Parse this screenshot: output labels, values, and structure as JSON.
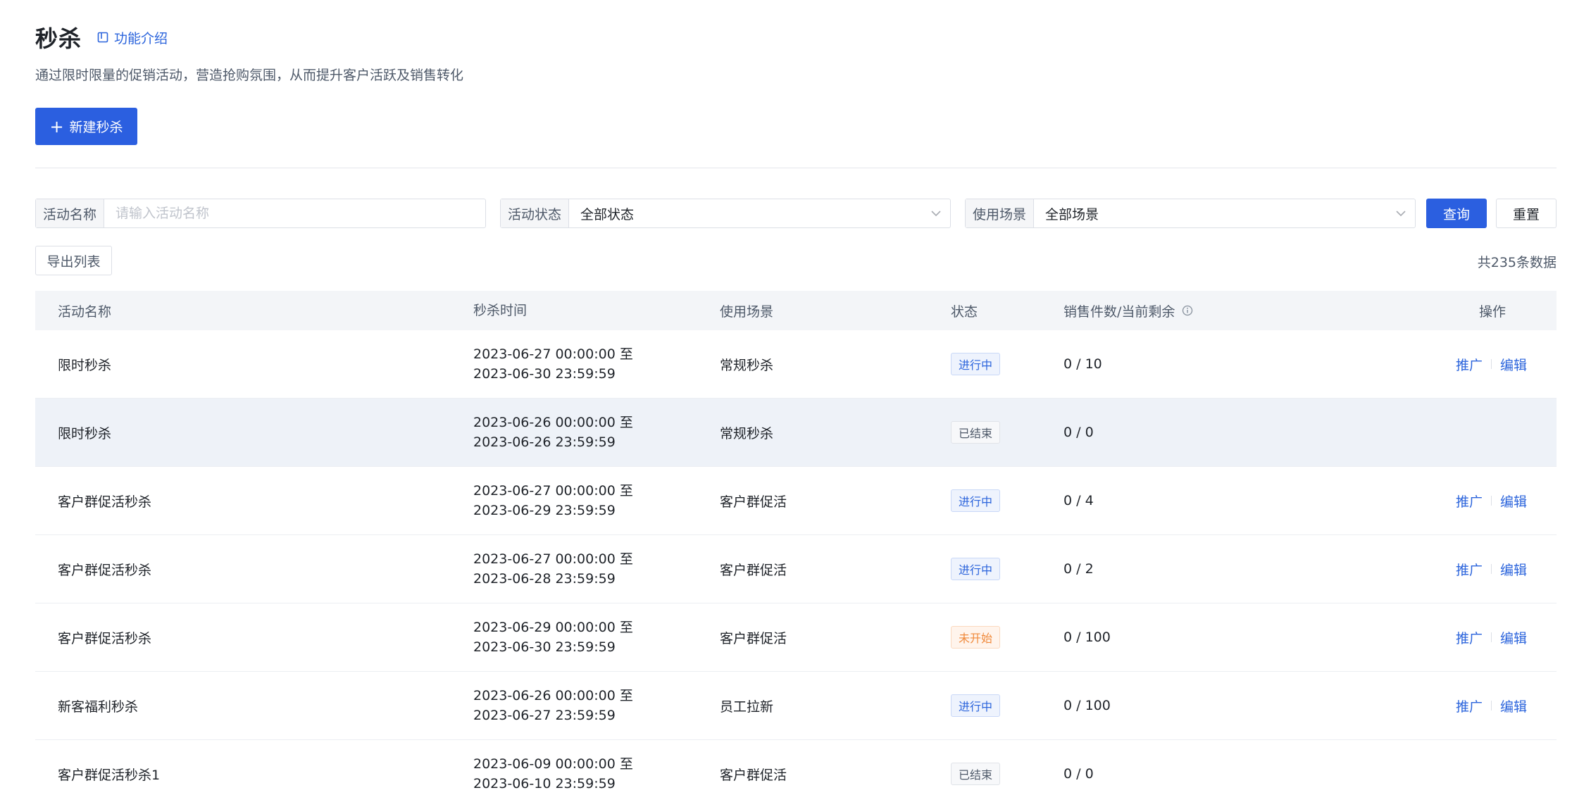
{
  "header": {
    "title": "秒杀",
    "intro_link": "功能介绍",
    "subtitle": "通过限时限量的促销活动，营造抢购氛围，从而提升客户活跃及销售转化",
    "create_button": "新建秒杀"
  },
  "filters": {
    "name_label": "活动名称",
    "name_placeholder": "请输入活动名称",
    "status_label": "活动状态",
    "status_value": "全部状态",
    "scene_label": "使用场景",
    "scene_value": "全部场景",
    "query_button": "查询",
    "reset_button": "重置"
  },
  "toolbar": {
    "export_button": "导出列表",
    "total_text": "共235条数据"
  },
  "table": {
    "columns": {
      "name": "活动名称",
      "time": "秒杀时间",
      "scene": "使用场景",
      "status": "状态",
      "sales": "销售件数/当前剩余",
      "ops": "操作"
    },
    "op_promote": "推广",
    "op_edit": "编辑",
    "rows": [
      {
        "name": "限时秒杀",
        "start": "2023-06-27 00:00:00 至",
        "end": "2023-06-30 23:59:59",
        "scene": "常规秒杀",
        "status": "进行中",
        "status_type": "running",
        "sales": "0 / 10",
        "ops": true
      },
      {
        "name": "限时秒杀",
        "start": "2023-06-26 00:00:00 至",
        "end": "2023-06-26 23:59:59",
        "scene": "常规秒杀",
        "status": "已结束",
        "status_type": "ended",
        "sales": "0 / 0",
        "ops": false
      },
      {
        "name": "客户群促活秒杀",
        "start": "2023-06-27 00:00:00 至",
        "end": "2023-06-29 23:59:59",
        "scene": "客户群促活",
        "status": "进行中",
        "status_type": "running",
        "sales": "0 / 4",
        "ops": true
      },
      {
        "name": "客户群促活秒杀",
        "start": "2023-06-27 00:00:00 至",
        "end": "2023-06-28 23:59:59",
        "scene": "客户群促活",
        "status": "进行中",
        "status_type": "running",
        "sales": "0 / 2",
        "ops": true
      },
      {
        "name": "客户群促活秒杀",
        "start": "2023-06-29 00:00:00 至",
        "end": "2023-06-30 23:59:59",
        "scene": "客户群促活",
        "status": "未开始",
        "status_type": "notstarted",
        "sales": "0 / 100",
        "ops": true
      },
      {
        "name": "新客福利秒杀",
        "start": "2023-06-26 00:00:00 至",
        "end": "2023-06-27 23:59:59",
        "scene": "员工拉新",
        "status": "进行中",
        "status_type": "running",
        "sales": "0 / 100",
        "ops": true
      },
      {
        "name": "客户群促活秒杀1",
        "start": "2023-06-09 00:00:00 至",
        "end": "2023-06-10 23:59:59",
        "scene": "客户群促活",
        "status": "已结束",
        "status_type": "ended",
        "sales": "0 / 0",
        "ops": false
      }
    ]
  },
  "colors": {
    "primary": "#2b5fe0",
    "link": "#2b64dc",
    "running": "#2b64dc",
    "ended": "#4e5969",
    "notstarted": "#f08a3c"
  }
}
